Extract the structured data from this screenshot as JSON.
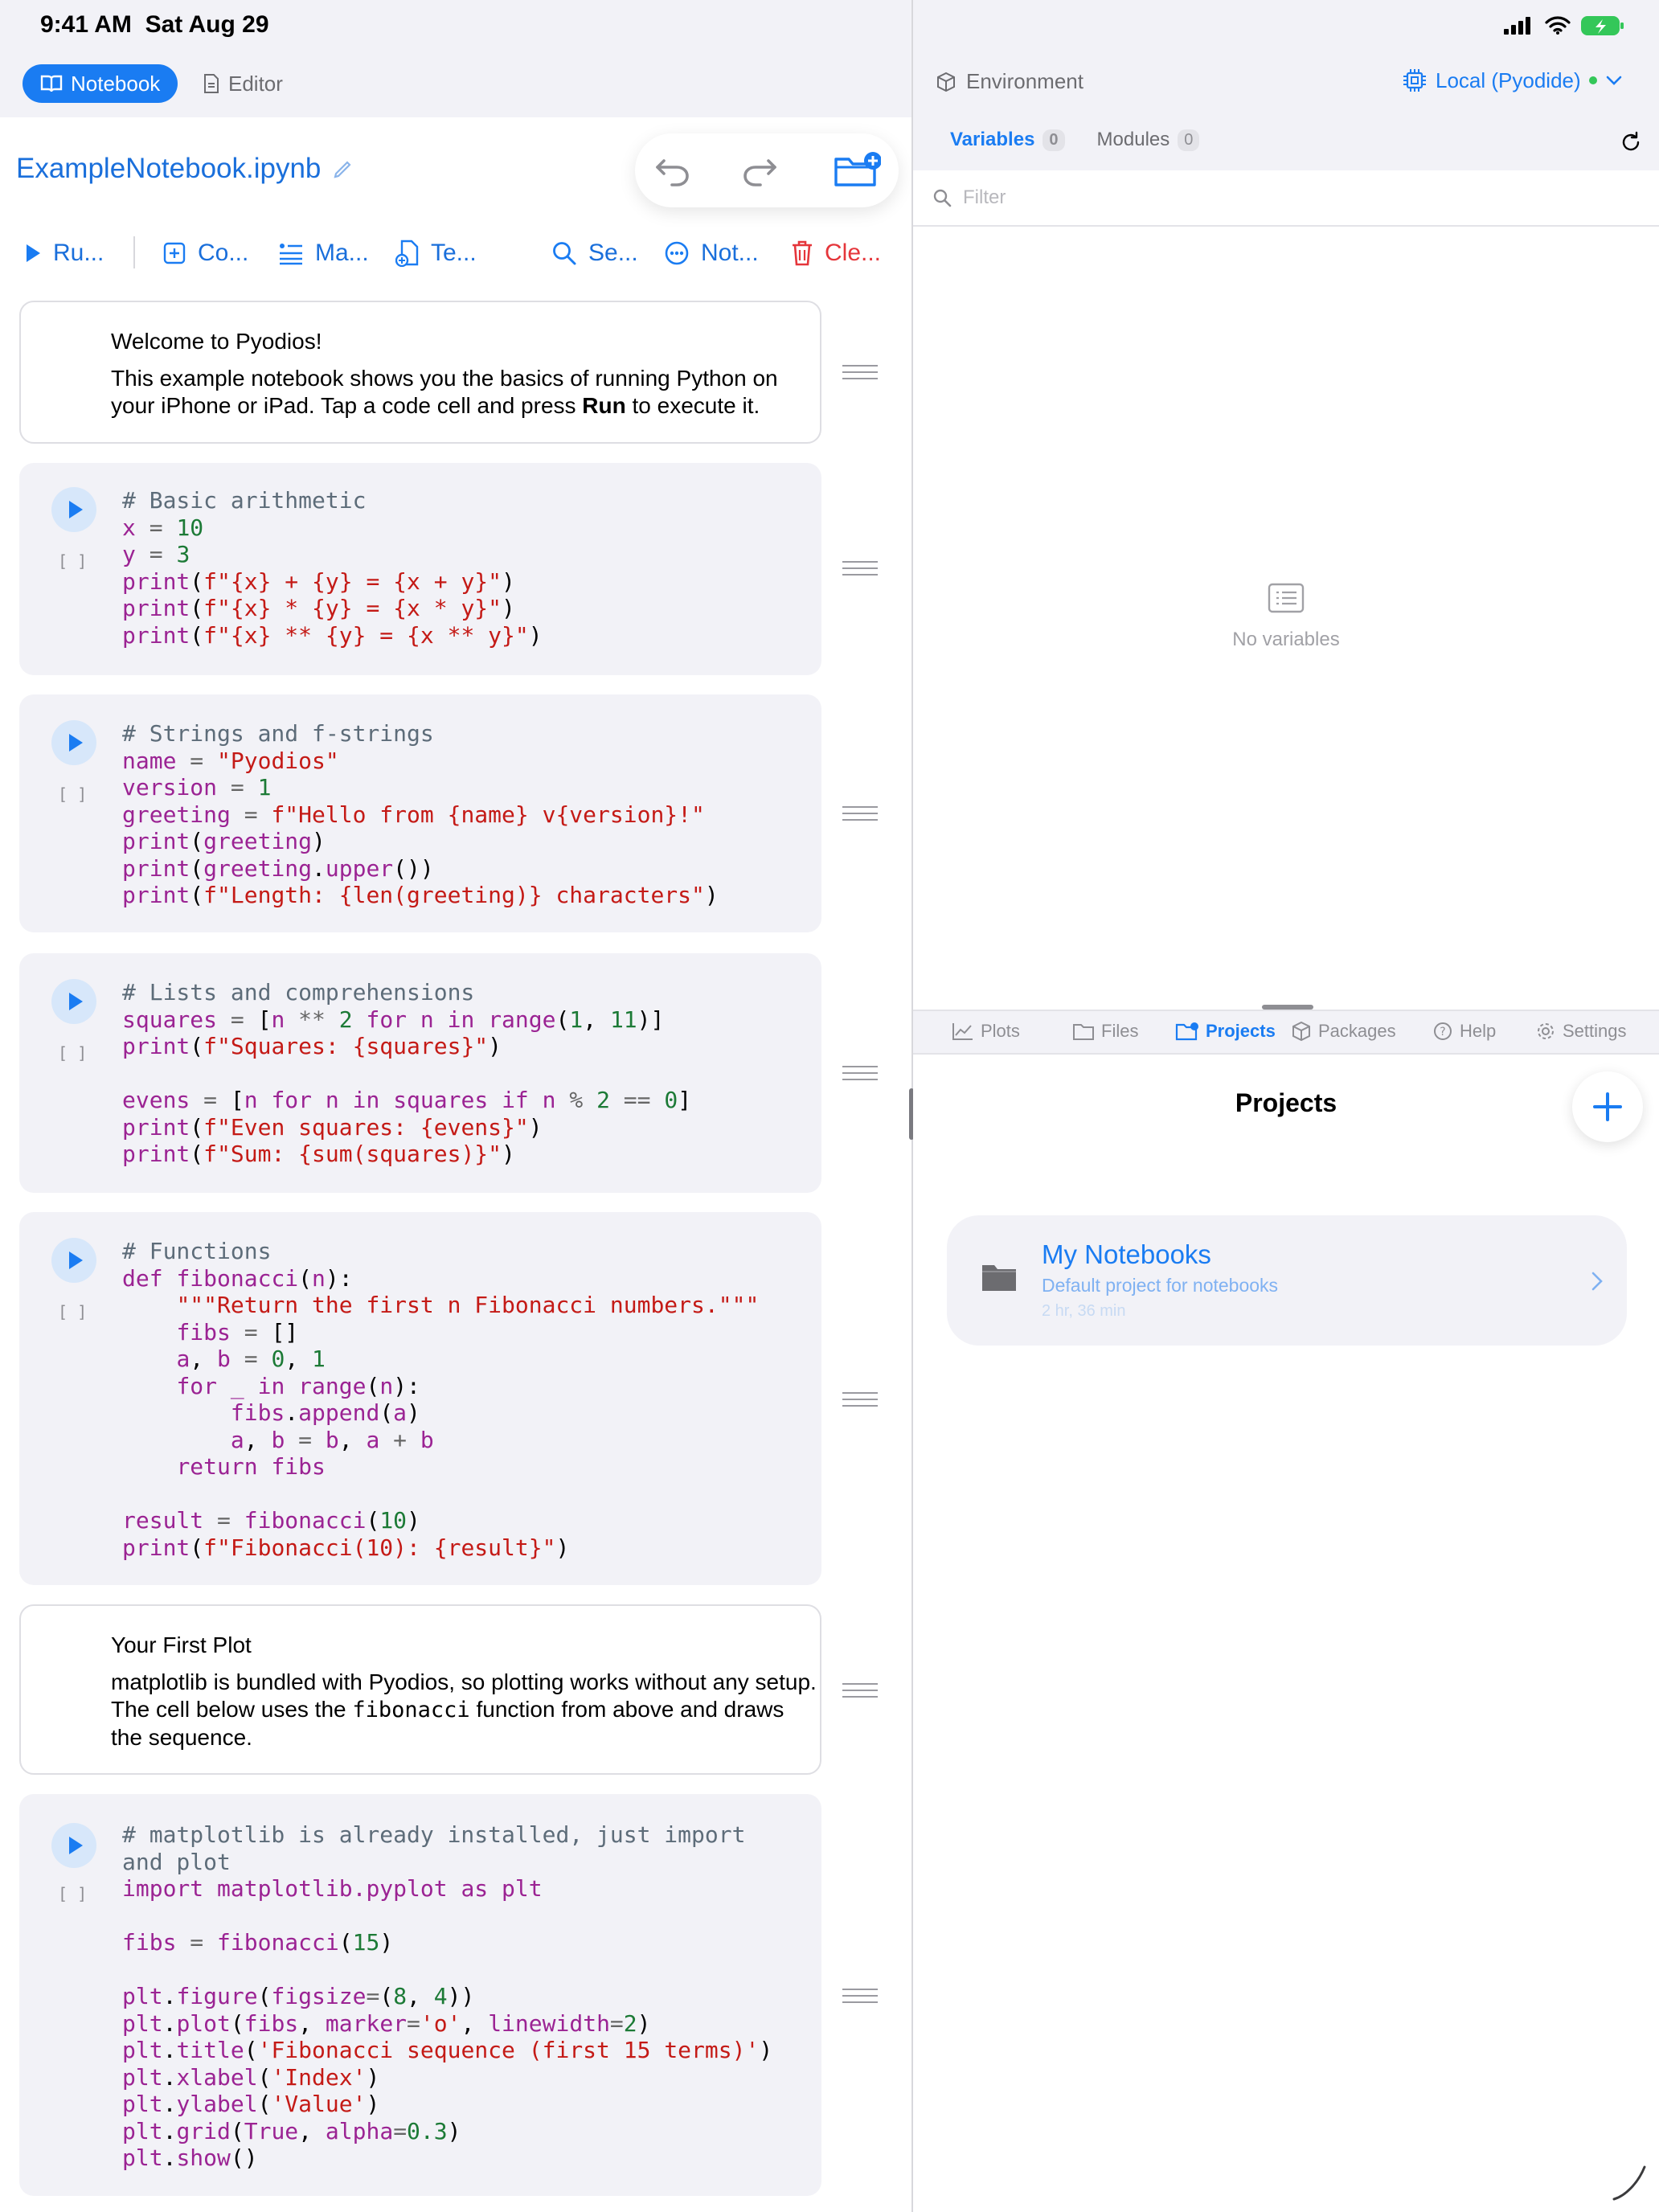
{
  "status_bar": {
    "time": "9:41 AM",
    "date": "Sat Aug 29"
  },
  "modes": {
    "notebook": "Notebook",
    "editor": "Editor"
  },
  "notebook": {
    "title": "ExampleNotebook.ipynb"
  },
  "toolbar": {
    "run": "Ru...",
    "code": "Co...",
    "markdown": "Ma...",
    "text": "Te...",
    "search": "Se...",
    "notebook": "Not...",
    "clear": "Cle..."
  },
  "cells": {
    "md1": {
      "title": "Welcome to Pyodios!",
      "text_a": "This example notebook shows you the basics of running Python on your iPhone or iPad. Tap a code cell and press ",
      "text_bold": "Run",
      "text_b": " to execute it."
    },
    "md2": {
      "title": "Your First Plot",
      "text_a": "matplotlib is bundled with Pyodios, so plotting works without any setup. The cell below uses the ",
      "text_code": "fibonacci",
      "text_b": " function from above and draws the sequence."
    },
    "exec_count": "[ ]"
  },
  "environment": {
    "label": "Environment",
    "kernel": "Local (Pyodide)"
  },
  "variables": {
    "tab_variables": "Variables",
    "tab_modules": "Modules",
    "variables_count": "0",
    "modules_count": "0",
    "filter_placeholder": "Filter",
    "empty": "No variables"
  },
  "bottom_tabs": {
    "plots": "Plots",
    "files": "Files",
    "projects": "Projects",
    "packages": "Packages",
    "help": "Help",
    "settings": "Settings"
  },
  "projects": {
    "title": "Projects",
    "items": [
      {
        "name": "My Notebooks",
        "description": "Default project for notebooks",
        "time": "2 hr, 36 min"
      }
    ]
  },
  "colors": {
    "accent": "#1a7cf2",
    "clear": "#e5363b",
    "status_green": "#34c759"
  }
}
